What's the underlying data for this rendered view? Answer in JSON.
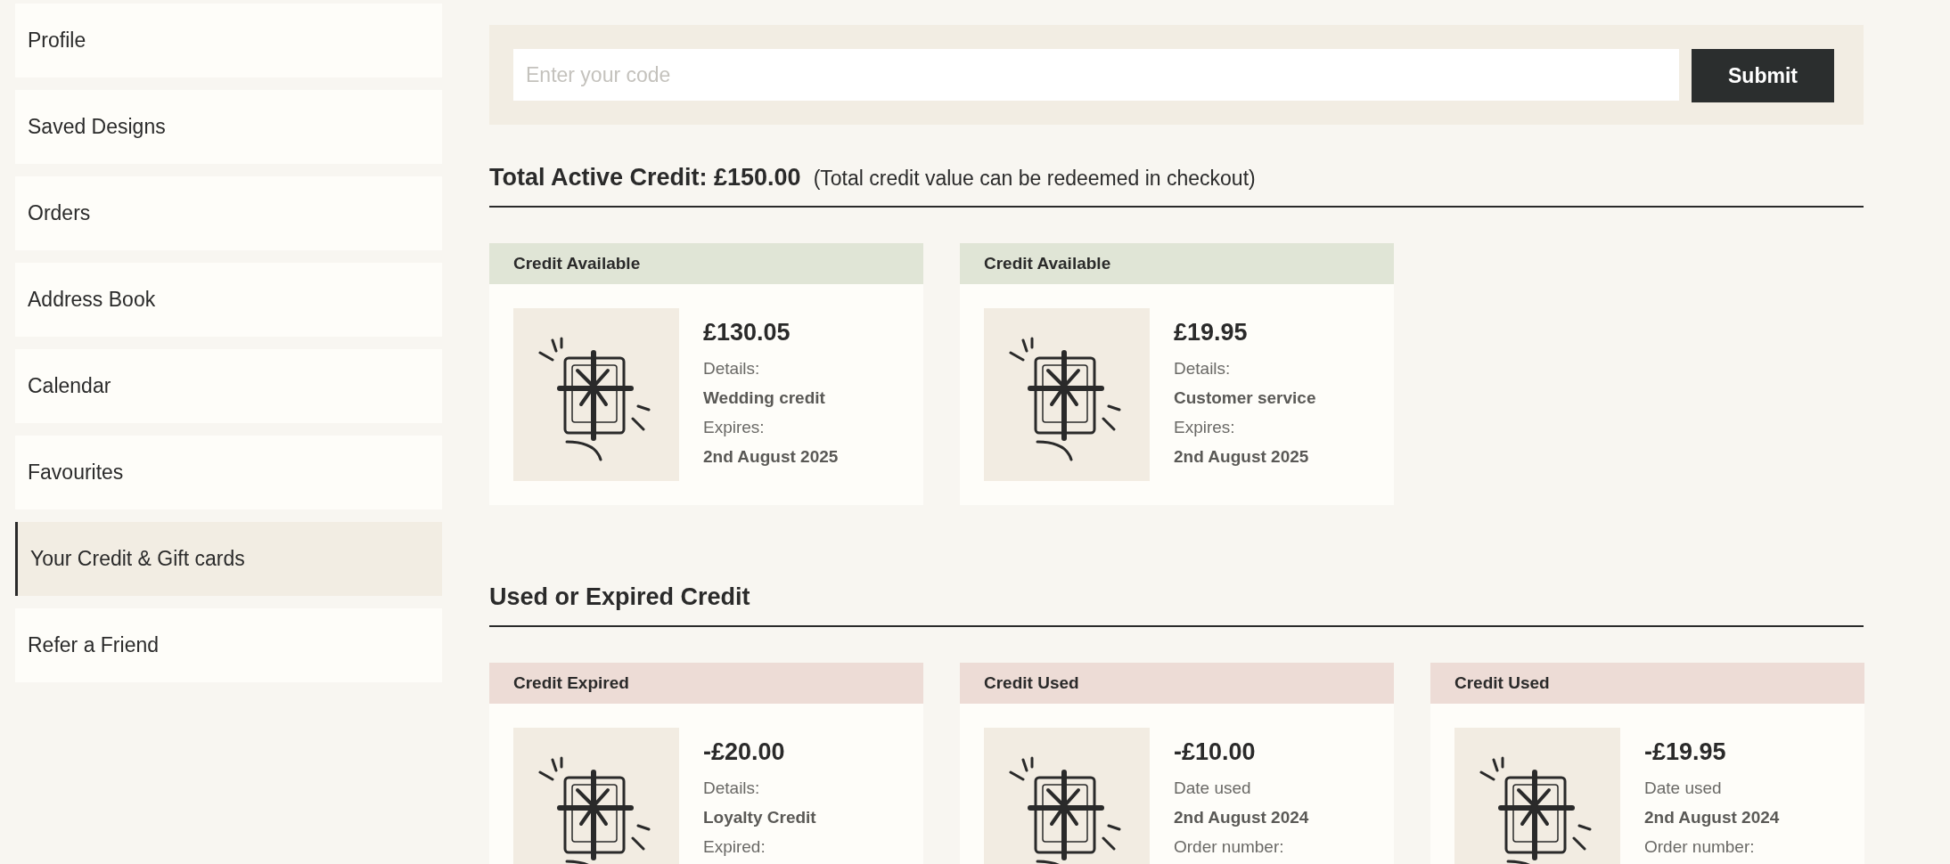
{
  "sidebar": {
    "items": [
      {
        "label": "Profile",
        "selected": false
      },
      {
        "label": "Saved Designs",
        "selected": false
      },
      {
        "label": "Orders",
        "selected": false
      },
      {
        "label": "Address Book",
        "selected": false
      },
      {
        "label": "Calendar",
        "selected": false
      },
      {
        "label": "Favourites",
        "selected": false
      },
      {
        "label": "Your Credit & Gift cards",
        "selected": true
      },
      {
        "label": "Refer a Friend",
        "selected": false
      }
    ]
  },
  "code_form": {
    "placeholder": "Enter your code",
    "button": "Submit"
  },
  "total": {
    "label": "Total Active Credit: £150.00",
    "note": "(Total credit value can be redeemed in checkout)"
  },
  "active_cards": [
    {
      "color": "#e0e5d6",
      "status": "Credit Available",
      "amount": "£130.05",
      "lines": [
        {
          "text": "Details:",
          "kind": "label"
        },
        {
          "text": "Wedding credit",
          "kind": "value"
        },
        {
          "text": "Expires:",
          "kind": "label"
        },
        {
          "text": "2nd August 2025",
          "kind": "value"
        }
      ]
    },
    {
      "color": "#e0e5d6",
      "status": "Credit Available",
      "amount": "£19.95",
      "lines": [
        {
          "text": "Details:",
          "kind": "label"
        },
        {
          "text": "Customer service",
          "kind": "value"
        },
        {
          "text": "Expires:",
          "kind": "label"
        },
        {
          "text": "2nd August 2025",
          "kind": "value"
        }
      ]
    }
  ],
  "used_title": "Used or Expired Credit",
  "used_cards": [
    {
      "color": "#eddcd6",
      "status": "Credit Expired",
      "amount": "-£20.00",
      "lines": [
        {
          "text": "Details:",
          "kind": "label"
        },
        {
          "text": "Loyalty Credit",
          "kind": "value"
        },
        {
          "text": "Expired:",
          "kind": "label"
        }
      ]
    },
    {
      "color": "#eddcd6",
      "status": "Credit Used",
      "amount": "-£10.00",
      "lines": [
        {
          "text": "Date used",
          "kind": "label"
        },
        {
          "text": "2nd August 2024",
          "kind": "value"
        },
        {
          "text": "Order number:",
          "kind": "label"
        }
      ]
    },
    {
      "color": "#eddcd6",
      "status": "Credit Used",
      "amount": "-£19.95",
      "lines": [
        {
          "text": "Date used",
          "kind": "label"
        },
        {
          "text": "2nd August 2024",
          "kind": "value"
        },
        {
          "text": "Order number:",
          "kind": "label"
        }
      ]
    }
  ]
}
